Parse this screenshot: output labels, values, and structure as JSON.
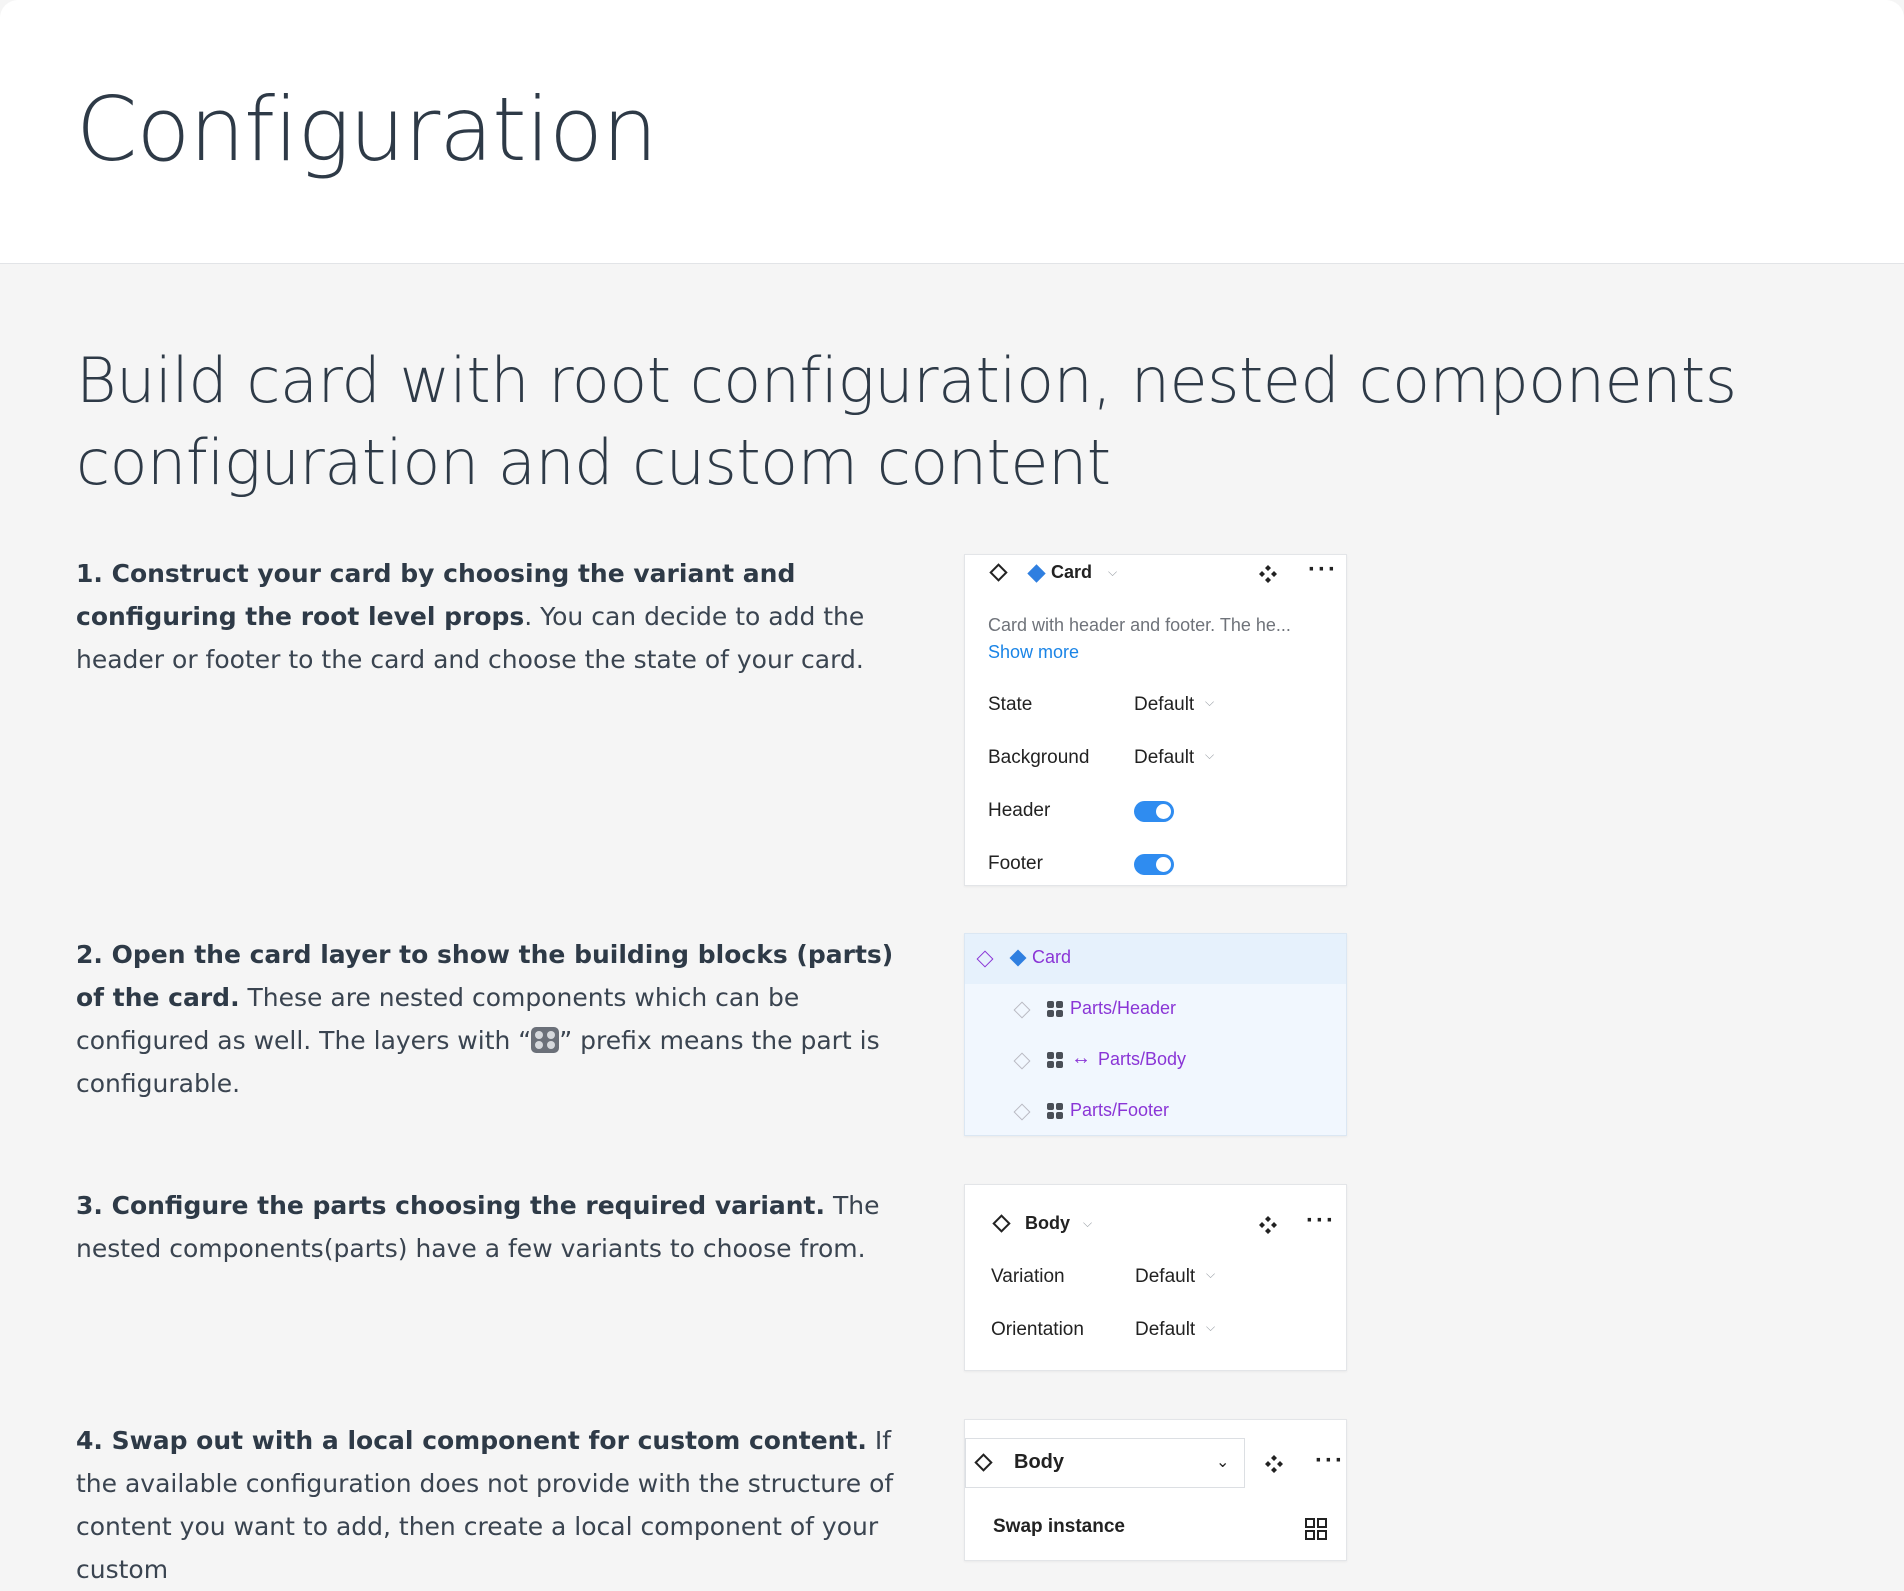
{
  "header": {
    "title": "Configuration"
  },
  "section": {
    "title": "Build card with root configuration, nested components configuration and custom content"
  },
  "steps": [
    {
      "bold": "1. Construct your card by choosing the variant and configuring the root level props",
      "rest": ". You can decide to add the header or footer to the card and choose the state of your card."
    },
    {
      "bold": "2. Open the card layer to show the building blocks (parts) of the card.",
      "rest_a": " These are nested components which can be configured as well. The layers with “",
      "rest_b": "” prefix means the part is configurable."
    },
    {
      "bold": "3. Configure the parts choosing the required variant.",
      "rest": " The nested components(parts) have a few variants to choose from."
    },
    {
      "bold": "4. Swap out with a local component for custom content.",
      "rest": " If the available configuration does not provide with the structure of content you want to add, then create a local component of your custom"
    }
  ],
  "panel1": {
    "component_name": "Card",
    "description": "Card with header and footer. The he...",
    "show_more": "Show more",
    "rows": [
      {
        "label": "State",
        "value": "Default"
      },
      {
        "label": "Background",
        "value": "Default"
      },
      {
        "label": "Header",
        "toggle": true
      },
      {
        "label": "Footer",
        "toggle": true
      }
    ]
  },
  "panel2": {
    "root": "Card",
    "children": [
      "Parts/Header",
      "Parts/Body",
      "Parts/Footer"
    ]
  },
  "panel3": {
    "component_name": "Body",
    "rows": [
      {
        "label": "Variation",
        "value": "Default"
      },
      {
        "label": "Orientation",
        "value": "Default"
      }
    ]
  },
  "panel4": {
    "component_name": "Body",
    "swap_label": "Swap instance"
  },
  "colors": {
    "accent_blue": "#2f8cf0",
    "link_blue": "#1a84e6",
    "layer_purple": "#8a35d6",
    "selected_row": "#e6f1fc"
  }
}
